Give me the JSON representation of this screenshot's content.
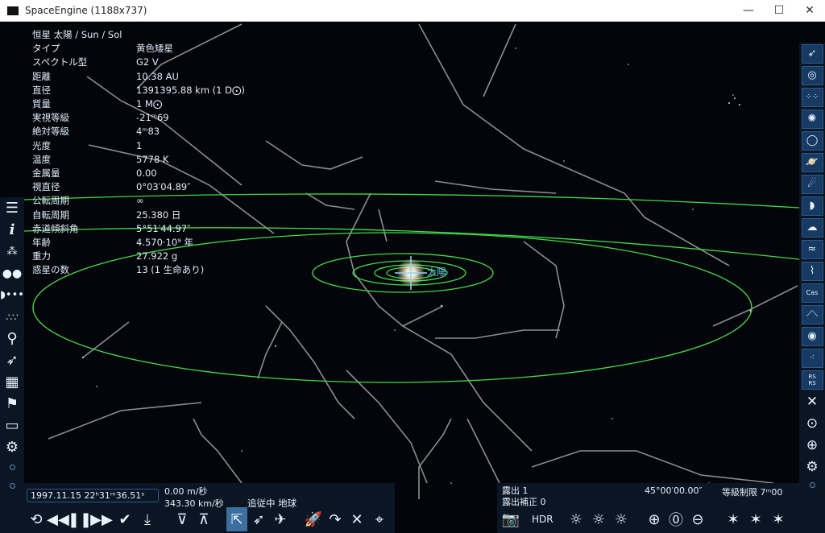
{
  "window": {
    "title": "SpaceEngine (1188x737)",
    "minimize": "—",
    "maximize": "☐",
    "close": "✕"
  },
  "object_info": {
    "header": "恒星  太陽 / Sun / Sol",
    "rows": [
      {
        "key": "タイプ",
        "value": "黄色矮星"
      },
      {
        "key": "スペクトル型",
        "value": "G2 V"
      },
      {
        "key": "距離",
        "value": "10.38 AU"
      },
      {
        "key": "直径",
        "value": "1391395.88 km (1 D⨀)"
      },
      {
        "key": "質量",
        "value": "1 M⨀"
      },
      {
        "key": "実視等級",
        "value": "-21ᵐ69"
      },
      {
        "key": "絶対等級",
        "value": "4ᵐ83"
      },
      {
        "key": "光度",
        "value": "1"
      },
      {
        "key": "温度",
        "value": "5778 K"
      },
      {
        "key": "金属量",
        "value": "0.00"
      },
      {
        "key": "視直径",
        "value": "0°03′04.89″"
      },
      {
        "key": "公転周期",
        "value": "∞"
      },
      {
        "key": "自転周期",
        "value": "25.380 日"
      },
      {
        "key": "赤道傾斜角",
        "value": "5°51′44.97″"
      },
      {
        "key": "年齢",
        "value": "4.570·10⁹ 年"
      },
      {
        "key": "重力",
        "value": "27.922 g"
      },
      {
        "key": "惑星の数",
        "value": "13 (1 生命あり)"
      }
    ]
  },
  "scene": {
    "sun_label": "太陽"
  },
  "left_toolbar": {
    "icons": [
      "menu-icon",
      "info-icon",
      "planetarium-icon",
      "binoculars-icon",
      "solar-system-icon",
      "stars-icon",
      "search-icon",
      "ship-icon",
      "calendar-icon",
      "flag-icon",
      "display-icon",
      "settings-icon"
    ]
  },
  "right_toolbar": {
    "icons": [
      "spacecraft-icon",
      "galaxy-icon",
      "star-clusters-icon",
      "nebula-icon",
      "ring-icon",
      "planet-ring-icon",
      "comet-icon",
      "asteroid-icon",
      "clouds-icon",
      "water-icon",
      "aurora-icon",
      "constellation-names-icon",
      "constellation-lines-icon",
      "orbits-icon",
      "markers-icon",
      "rs-label-icon",
      "grid-icon",
      "center-icon",
      "globe-icon",
      "settings-icon"
    ],
    "labels": {
      "cas": "Cas",
      "rs1": "RS",
      "rs2": "RS"
    }
  },
  "bottom_left": {
    "datetime": "1997.11.15 22ʰ31ᵐ36.51ˢ",
    "speed1": "0.00 m/秒",
    "speed2": "343.30 km/秒",
    "tracking": "追従中 地球"
  },
  "bottom_right": {
    "exposure": "露出 1",
    "exposure_comp": "露出補正 0",
    "fov": "45°00′00.00″",
    "mag_limit": "等級制限  7ᵐ00",
    "hdr": "HDR"
  },
  "colors": {
    "orbit": "#3fdc47",
    "constellation_line": "#8d8d8d",
    "toolbar_bg": "#0b1624",
    "button_bg": "#173a63",
    "label_cyan": "#5fc7e6"
  }
}
